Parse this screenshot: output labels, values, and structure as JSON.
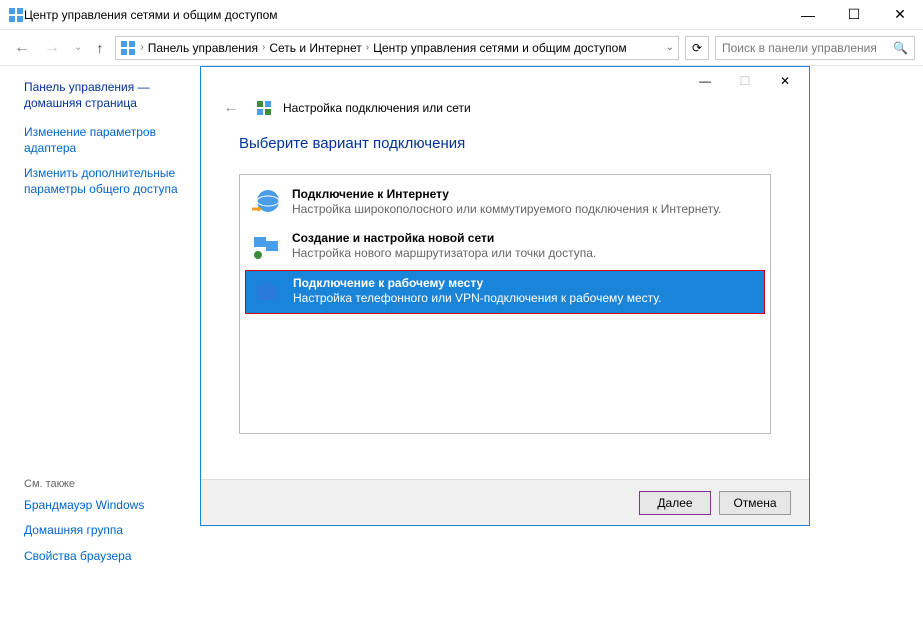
{
  "window": {
    "title": "Центр управления сетями и общим доступом"
  },
  "breadcrumb": {
    "items": [
      "Панель управления",
      "Сеть и Интернет",
      "Центр управления сетями и общим доступом"
    ]
  },
  "search": {
    "placeholder": "Поиск в панели управления"
  },
  "sidebar": {
    "home": "Панель управления — домашняя страница",
    "links": [
      "Изменение параметров адаптера",
      "Изменить дополнительные параметры общего доступа"
    ],
    "seealso": "См. также",
    "seeitems": [
      "Брандмауэр Windows",
      "Домашняя группа",
      "Свойства браузера"
    ]
  },
  "dialog": {
    "headline": "Настройка подключения или сети",
    "heading": "Выберите вариант подключения",
    "options": [
      {
        "title": "Подключение к Интернету",
        "desc": "Настройка широкополосного или коммутируемого подключения к Интернету."
      },
      {
        "title": "Создание и настройка новой сети",
        "desc": "Настройка нового маршрутизатора или точки доступа."
      },
      {
        "title": "Подключение к рабочему месту",
        "desc": "Настройка телефонного или VPN-подключения к рабочему месту."
      }
    ],
    "buttons": {
      "next": "Далее",
      "cancel": "Отмена"
    }
  }
}
